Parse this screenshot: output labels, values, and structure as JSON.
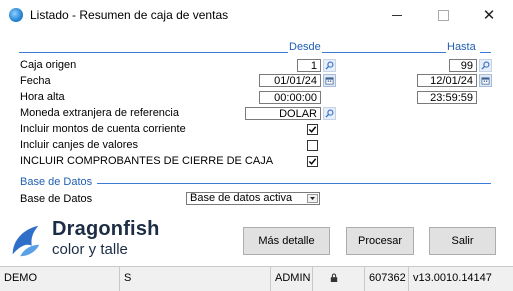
{
  "window": {
    "title": "Listado - Resumen de caja de ventas"
  },
  "columns": {
    "desde": "Desde",
    "hasta": "Hasta"
  },
  "rows": {
    "caja_origen": {
      "label": "Caja origen",
      "desde": "1",
      "hasta": "99"
    },
    "fecha": {
      "label": "Fecha",
      "desde": "01/01/24",
      "hasta": "12/01/24"
    },
    "hora_alta": {
      "label": "Hora alta",
      "desde": "00:00:00",
      "hasta": "23:59:59"
    },
    "moneda": {
      "label": "Moneda extranjera de referencia",
      "value": "DOLAR"
    }
  },
  "checkboxes": [
    {
      "label": "Incluir montos de cuenta corriente",
      "checked": true
    },
    {
      "label": "Incluir canjes de valores",
      "checked": false
    },
    {
      "label": "INCLUIR COMPROBANTES DE CIERRE DE CAJA",
      "checked": true
    }
  ],
  "base_datos": {
    "section": "Base de Datos",
    "label": "Base de Datos",
    "selected": "Base de datos activa"
  },
  "brand": {
    "name": "Dragonfish",
    "tagline": "color y talle"
  },
  "buttons": {
    "detalle": "Más detalle",
    "procesar": "Procesar",
    "salir": "Salir"
  },
  "status": {
    "db": "DEMO",
    "mode": "S",
    "user": "ADMIN",
    "serial": "607362",
    "version": "v13.0010.14147"
  },
  "colors": {
    "accent": "#3a7bd5",
    "section_text": "#1f5fb3",
    "brand": "#1d2d44"
  },
  "icons": [
    "app-icon",
    "search-icon",
    "calendar-icon",
    "lock-icon",
    "check-icon",
    "dropdown-arrow-icon"
  ]
}
